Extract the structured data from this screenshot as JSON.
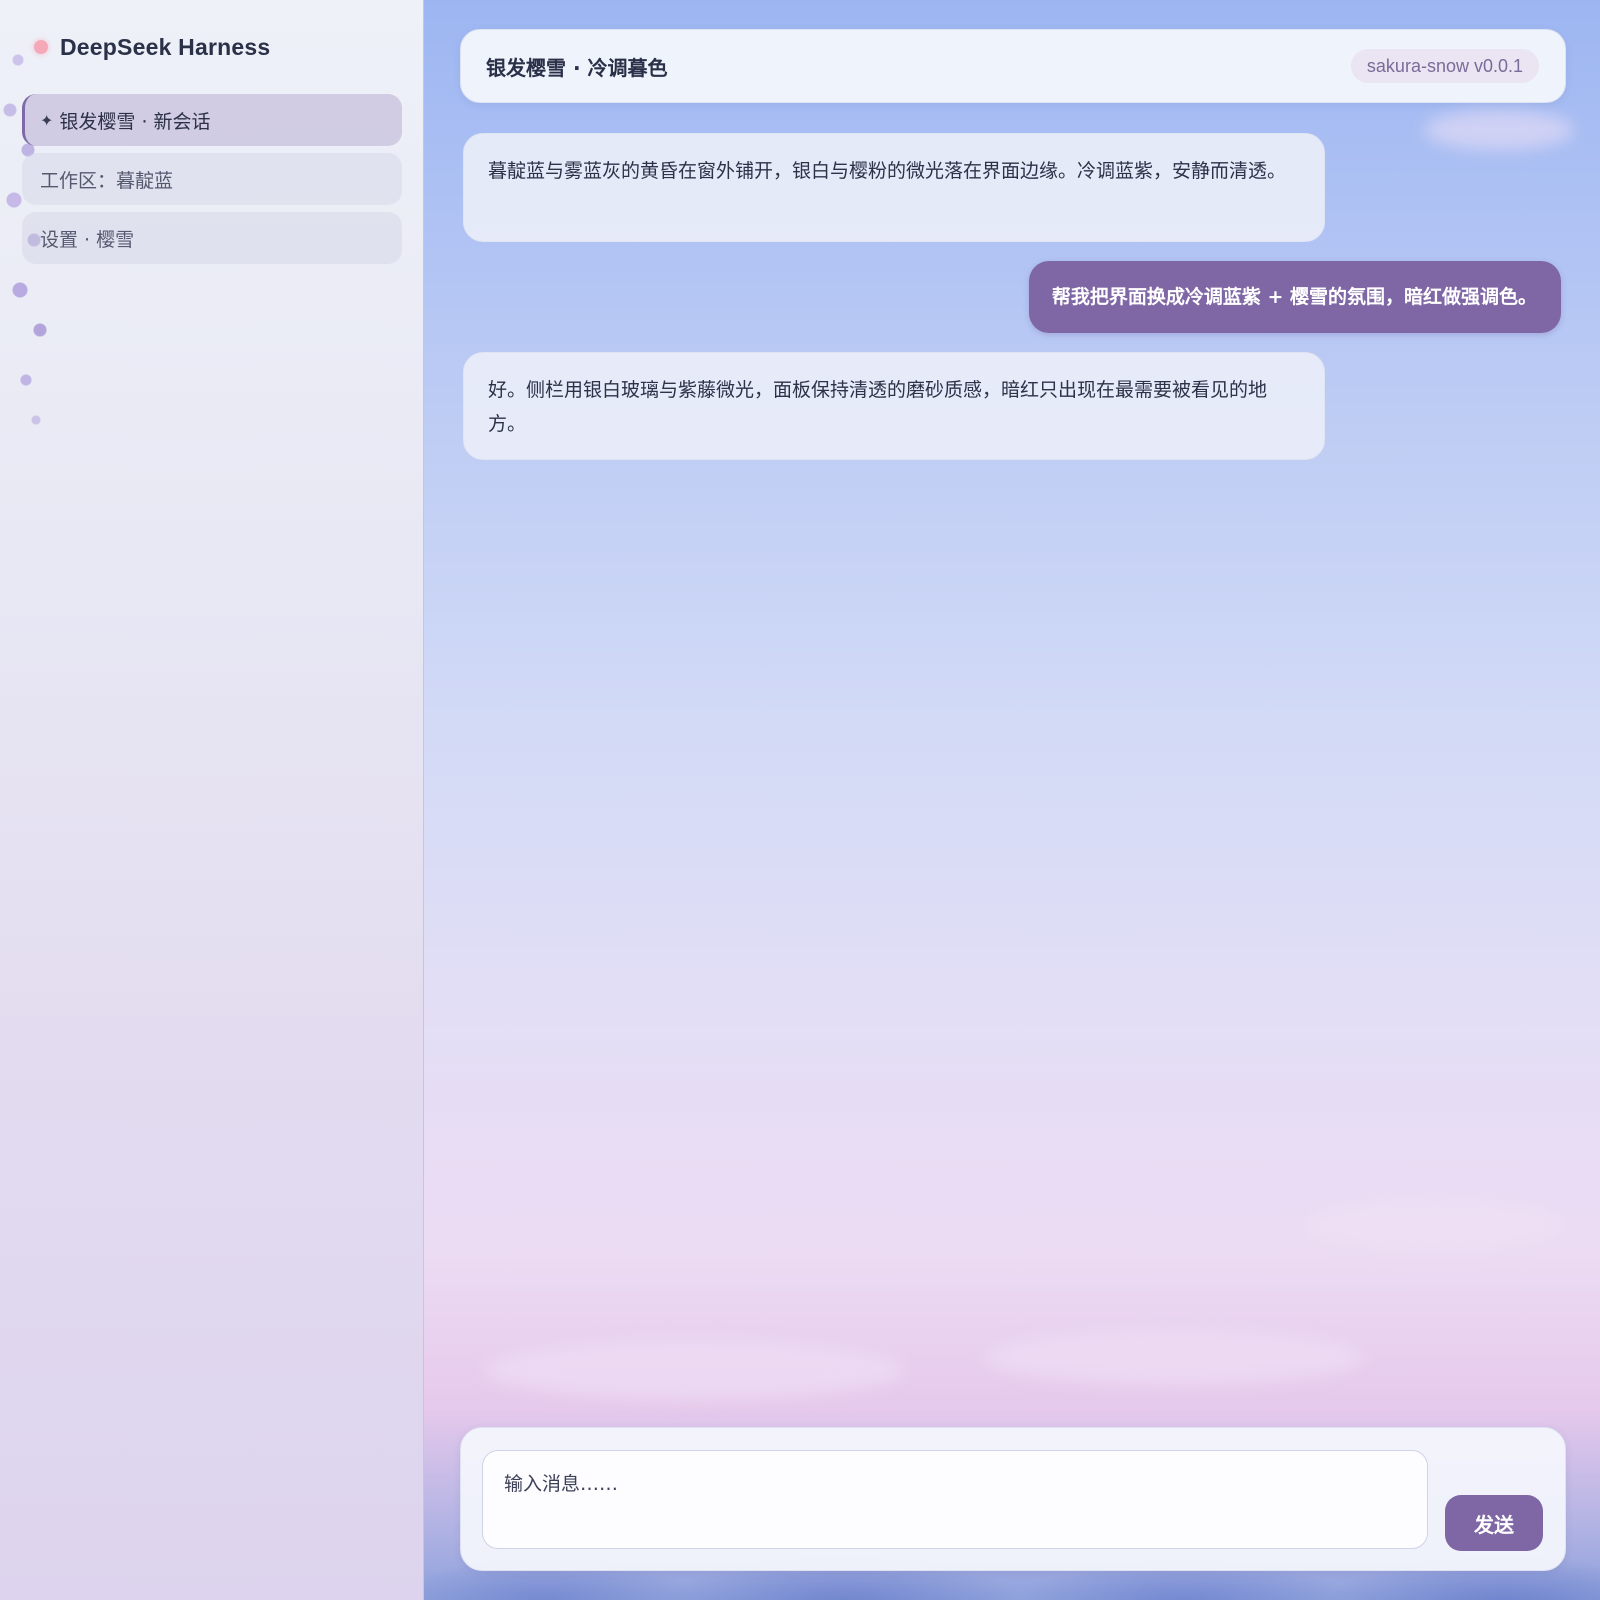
{
  "app": {
    "title": "DeepSeek Harness"
  },
  "sidebar": {
    "items": [
      {
        "icon": "sparkle-icon",
        "glyph": "✦",
        "label": "银发樱雪 · 新会话",
        "active": true
      },
      {
        "label": "工作区：暮靛蓝",
        "active": false
      },
      {
        "label": "设置 · 樱雪",
        "active": false
      }
    ]
  },
  "header": {
    "title": "银发樱雪 · 冷调暮色",
    "version": "sakura-snow v0.0.1"
  },
  "messages": [
    {
      "role": "assistant",
      "text": "暮靛蓝与雾蓝灰的黄昏在窗外铺开，银白与樱粉的微光落在界面边缘。冷调蓝紫，安静而清透。"
    },
    {
      "role": "user",
      "text": "帮我把界面换成冷调蓝紫 + 樱雪的氛围，暗红做强调色。"
    },
    {
      "role": "assistant",
      "text": "好。侧栏用银白玻璃与紫藤微光，面板保持清透的磨砂质感，暗红只出现在最需要被看见的地方。"
    }
  ],
  "composer": {
    "placeholder": "输入消息……",
    "send_label": "发送"
  },
  "colors": {
    "accent": "#7f67a5",
    "brand_dot": "#f4a8b8",
    "badge_bg": "#eae4f3",
    "badge_text": "#7b6b98"
  }
}
